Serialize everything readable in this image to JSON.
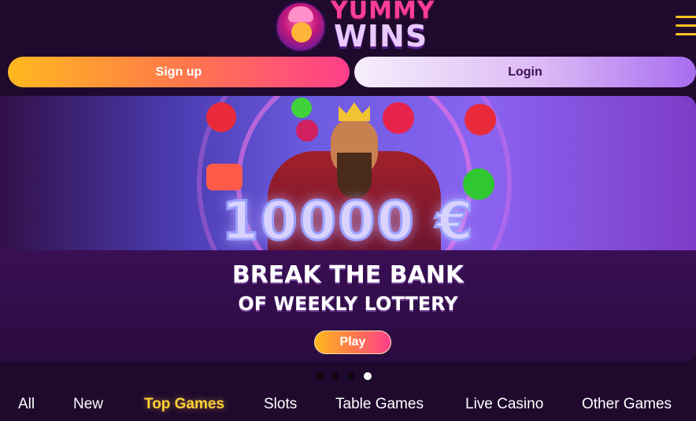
{
  "header": {
    "logo": {
      "line1": "YUMMY",
      "line2": "WINS"
    },
    "menu_icon": "hamburger-menu-icon"
  },
  "auth": {
    "signup_label": "Sign up",
    "login_label": "Login"
  },
  "banner": {
    "jackpot_text": "10000 €",
    "headline": "BREAK THE BANK",
    "subheadline": "OF WEEKLY LOTTERY",
    "play_label": "Play",
    "slide_count": 4,
    "active_slide": 4
  },
  "categories": {
    "items": [
      {
        "label": "All",
        "active": false
      },
      {
        "label": "New",
        "active": false
      },
      {
        "label": "Top Games",
        "active": true
      },
      {
        "label": "Slots",
        "active": false
      },
      {
        "label": "Table Games",
        "active": false
      },
      {
        "label": "Live Casino",
        "active": false
      },
      {
        "label": "Other Games",
        "active": false
      }
    ]
  },
  "colors": {
    "background": "#1f0a2e",
    "accent_gold": "#ffd23a",
    "signup_gradient_start": "#ffb81f",
    "signup_gradient_end": "#ff3e8c",
    "login_gradient_end": "#a86cf0"
  }
}
